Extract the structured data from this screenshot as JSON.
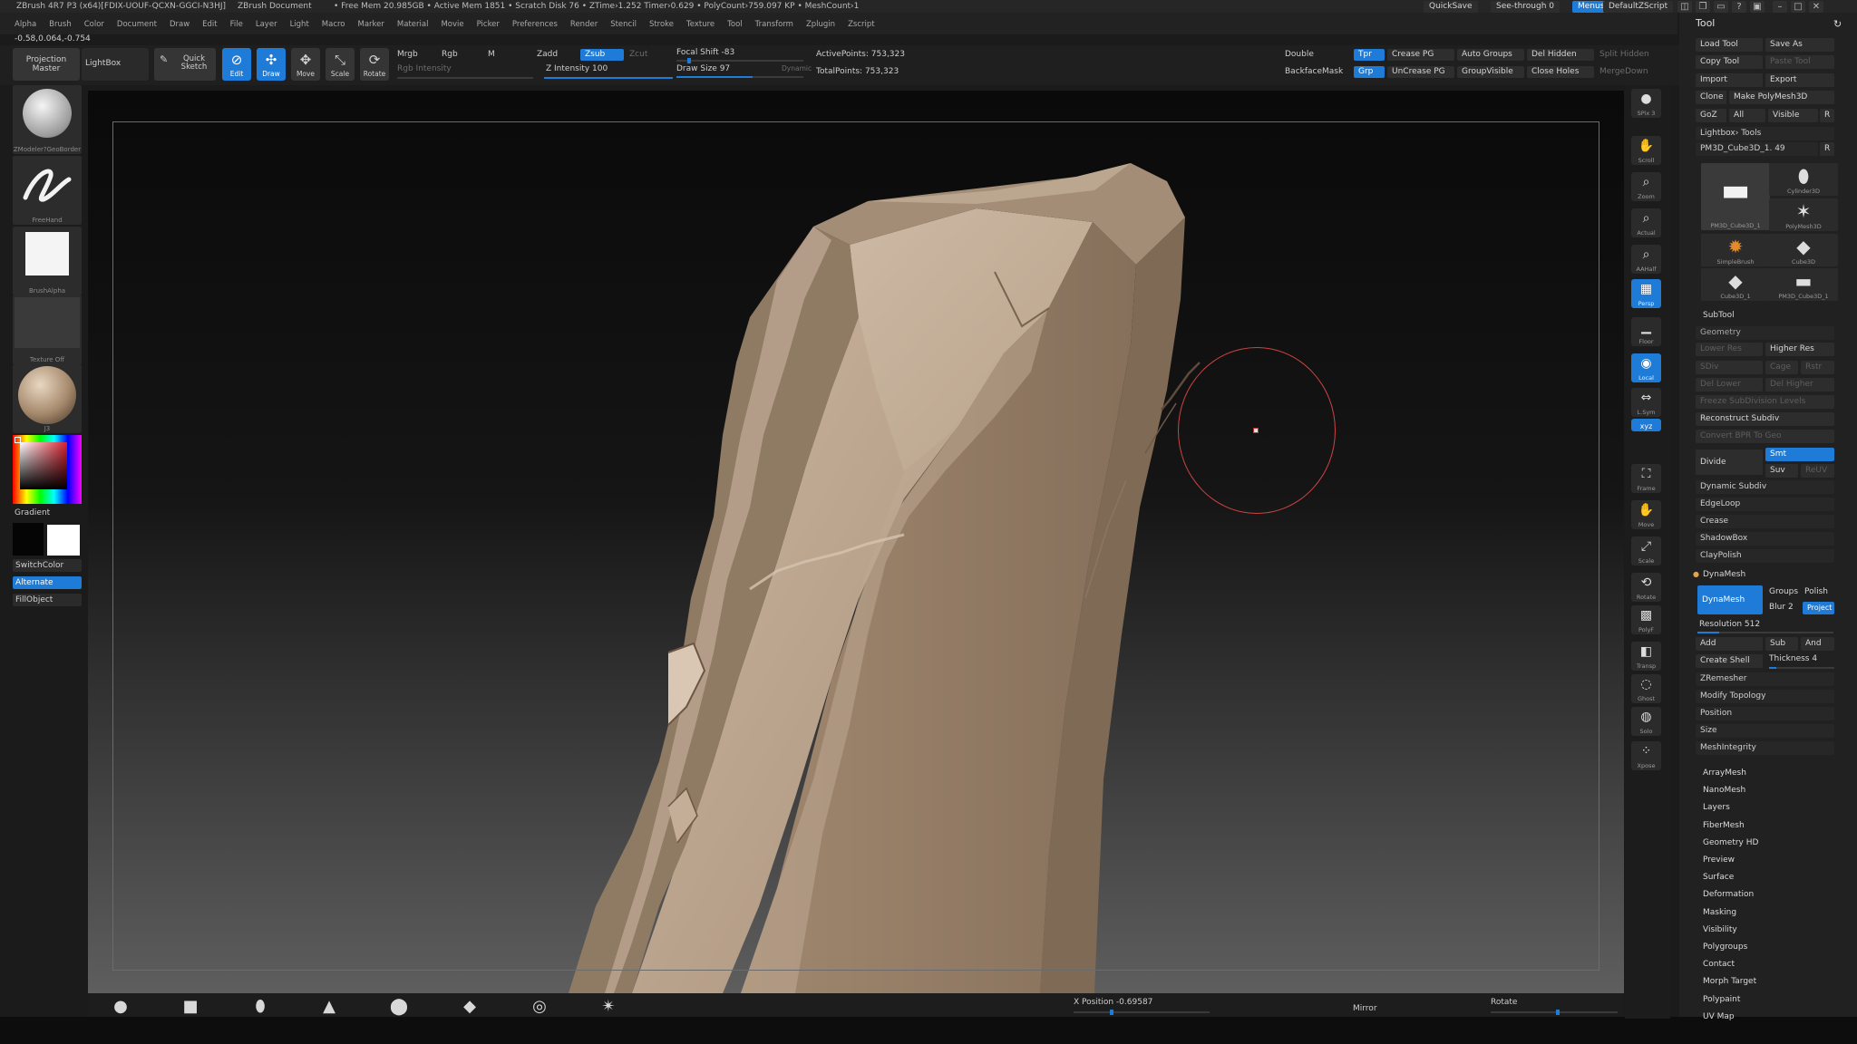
{
  "titlebar": {
    "app": "ZBrush 4R7 P3 (x64)[FDIX-UOUF-QCXN-GGCI-N3HJ]",
    "document": "ZBrush Document",
    "stats": "• Free Mem 20.985GB • Active Mem 1851 • Scratch Disk 76 • ZTime›1.252 Timer›0.629 • PolyCount›759.097 KP • MeshCount›1",
    "quicksave": "QuickSave",
    "see_through": "See-through  0",
    "menus": "Menus",
    "script": "DefaultZScript"
  },
  "menubar": [
    "Alpha",
    "Brush",
    "Color",
    "Document",
    "Draw",
    "Edit",
    "File",
    "Layer",
    "Light",
    "Macro",
    "Marker",
    "Material",
    "Movie",
    "Picker",
    "Preferences",
    "Render",
    "Stencil",
    "Stroke",
    "Texture",
    "Tool",
    "Transform",
    "Zplugin",
    "Zscript"
  ],
  "coords": "-0.58,0.064,-0.754",
  "toolbar": {
    "projection_master": "Projection Master",
    "lightbox": "LightBox",
    "quick_sketch": "Quick Sketch",
    "edit": "Edit",
    "draw": "Draw",
    "move": "Move",
    "scale": "Scale",
    "rotate": "Rotate",
    "mrgb": "Mrgb",
    "rgb": "Rgb",
    "m": "M",
    "rgb_intensity": "Rgb Intensity",
    "zadd": "Zadd",
    "zsub": "Zsub",
    "zcut": "Zcut",
    "z_intensity": "Z Intensity 100",
    "z_intensity_value": 100,
    "focal_shift": "Focal Shift -83",
    "focal_shift_value": -83,
    "draw_size": "Draw Size 97",
    "draw_size_value": 97,
    "dynamic": "Dynamic",
    "active_points": "ActivePoints: 753,323",
    "total_points": "TotalPoints: 753,323",
    "double": "Double",
    "tpr": "Tpr",
    "crease_pg": "Crease PG",
    "auto_groups": "Auto Groups",
    "del_hidden": "Del Hidden",
    "split_hidden": "Split Hidden",
    "backface_mask": "BackfaceMask",
    "grp": "Grp",
    "uncrease_pg": "UnCrease PG",
    "group_visible": "GroupVisible",
    "close_holes": "Close Holes",
    "merge_down": "MergeDown"
  },
  "left_shelf": {
    "brush": "ZModeler?GeoBorder",
    "stroke": "FreeHand",
    "alpha": "BrushAlpha",
    "texture": "Texture Off",
    "material": "J3",
    "gradient": "Gradient",
    "switch_color": "SwitchColor",
    "alternate": "Alternate",
    "fill_object": "FillObject"
  },
  "right_strip": [
    {
      "label": "SPix 3",
      "icon": "sphere-icon"
    },
    {
      "label": "Scroll",
      "icon": "hand-icon"
    },
    {
      "label": "Zoom",
      "icon": "magnifier-icon"
    },
    {
      "label": "Actual",
      "icon": "magnifier-icon"
    },
    {
      "label": "AAHalf",
      "icon": "magnifier-icon"
    },
    {
      "label": "Persp",
      "icon": "grid-icon"
    },
    {
      "label": "Floor",
      "icon": "floor-icon"
    },
    {
      "label": "Local",
      "icon": "local-icon"
    },
    {
      "label": "L.Sym",
      "icon": "symmetry-icon"
    },
    {
      "label": "xyz",
      "icon": "axis-icon"
    },
    {
      "label": "Frame",
      "icon": "frame-icon"
    },
    {
      "label": "Move",
      "icon": "hand-icon"
    },
    {
      "label": "Scale",
      "icon": "scale-icon"
    },
    {
      "label": "Rotate",
      "icon": "rotate-icon"
    },
    {
      "label": "PolyF",
      "icon": "polyframe-icon"
    },
    {
      "label": "Transp",
      "icon": "transp-icon"
    },
    {
      "label": "Ghost",
      "icon": "ghost-icon"
    },
    {
      "label": "Solo",
      "icon": "solo-icon"
    },
    {
      "label": "Xpose",
      "icon": "xpose-icon"
    }
  ],
  "tool_panel": {
    "title": "Tool",
    "load_tool": "Load Tool",
    "save_as": "Save As",
    "copy_tool": "Copy Tool",
    "paste_tool": "Paste Tool",
    "import": "Import",
    "export": "Export",
    "clone": "Clone",
    "make_polymesh": "Make PolyMesh3D",
    "goz": "GoZ",
    "all": "All",
    "visible": "Visible",
    "r": "R",
    "lightbox_tools": "Lightbox› Tools",
    "current_tool": "PM3D_Cube3D_1. 49",
    "tiles": [
      {
        "name": "PM3D_Cube3D_1",
        "icon": "mesh-icon"
      },
      {
        "name": "Cylinder3D",
        "icon": "cylinder-icon"
      },
      {
        "name": "PolyMesh3D",
        "icon": "star-icon"
      },
      {
        "name": "SimpleBrush",
        "icon": "brush-icon"
      },
      {
        "name": "Cube3D",
        "icon": "cube-icon"
      },
      {
        "name": "Cube3D_1",
        "icon": "cube-icon"
      },
      {
        "name": "PM3D_Cube3D_1",
        "icon": "mesh-icon"
      }
    ],
    "subtool": "SubTool",
    "geometry": "Geometry",
    "lower_res": "Lower Res",
    "higher_res": "Higher Res",
    "sdiv": "SDiv",
    "cage": "Cage",
    "rstr": "Rstr",
    "del_lower": "Del Lower",
    "del_higher": "Del Higher",
    "freeze_subdiv": "Freeze SubDivision Levels",
    "reconstruct_subdiv": "Reconstruct Subdiv",
    "convert_bpr": "Convert BPR To Geo",
    "divide": "Divide",
    "smt": "Smt",
    "suv": "Suv",
    "reuv": "ReUV",
    "dynamic_subdiv": "Dynamic Subdiv",
    "edgeloop": "EdgeLoop",
    "crease": "Crease",
    "shadowbox": "ShadowBox",
    "claypolish": "ClayPolish",
    "dynamesh_section": "DynaMesh",
    "dynamesh_btn": "DynaMesh",
    "groups": "Groups",
    "polish": "Polish",
    "blur": "Blur 2",
    "project": "Project",
    "resolution": "Resolution 512",
    "add": "Add",
    "sub": "Sub",
    "and": "And",
    "create_shell": "Create Shell",
    "thickness": "Thickness 4",
    "zremesher": "ZRemesher",
    "modify_topology": "Modify Topology",
    "position": "Position",
    "size": "Size",
    "meshintegrity": "MeshIntegrity",
    "sections": [
      "ArrayMesh",
      "NanoMesh",
      "Layers",
      "FiberMesh",
      "Geometry HD",
      "Preview",
      "Surface",
      "Deformation",
      "Masking",
      "Visibility",
      "Polygroups",
      "Contact",
      "Morph Target",
      "Polypaint",
      "UV Map"
    ]
  },
  "bottom": {
    "x_position": "X Position -0.69587",
    "mirror": "Mirror",
    "rotate": "Rotate"
  },
  "colors": {
    "accent": "#1e7bd8",
    "clay": "#b49d86",
    "brush_cursor": "#cc4444"
  }
}
